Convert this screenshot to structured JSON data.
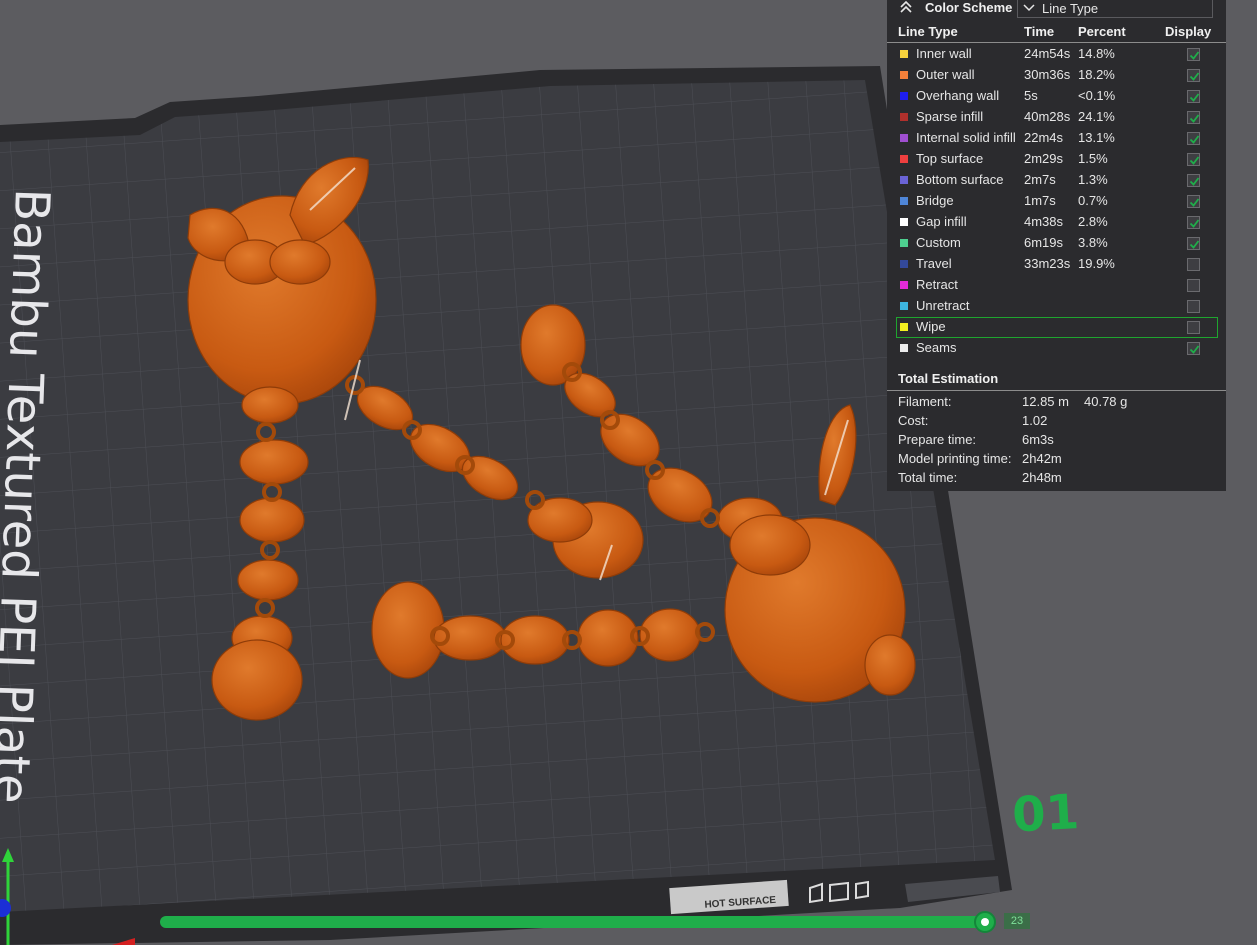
{
  "legend": {
    "scheme_title": "Color Scheme",
    "scheme_value": "Line Type",
    "headers": {
      "line_type": "Line Type",
      "time": "Time",
      "percent": "Percent",
      "display": "Display"
    },
    "rows": [
      {
        "name": "Inner wall",
        "time": "24m54s",
        "percent": "14.8%",
        "color": "#f7d23d",
        "display": true
      },
      {
        "name": "Outer wall",
        "time": "30m36s",
        "percent": "18.2%",
        "color": "#f5803a",
        "display": true
      },
      {
        "name": "Overhang wall",
        "time": "5s",
        "percent": "<0.1%",
        "color": "#1e1ef0",
        "display": true
      },
      {
        "name": "Sparse infill",
        "time": "40m28s",
        "percent": "24.1%",
        "color": "#b0302c",
        "display": true
      },
      {
        "name": "Internal solid infill",
        "time": "22m4s",
        "percent": "13.1%",
        "color": "#a04fd1",
        "display": true
      },
      {
        "name": "Top surface",
        "time": "2m29s",
        "percent": "1.5%",
        "color": "#ee3f3f",
        "display": true
      },
      {
        "name": "Bottom surface",
        "time": "2m7s",
        "percent": "1.3%",
        "color": "#6a63d6",
        "display": true
      },
      {
        "name": "Bridge",
        "time": "1m7s",
        "percent": "0.7%",
        "color": "#4f86d8",
        "display": true
      },
      {
        "name": "Gap infill",
        "time": "4m38s",
        "percent": "2.8%",
        "color": "#ffffff",
        "display": true
      },
      {
        "name": "Custom",
        "time": "6m19s",
        "percent": "3.8%",
        "color": "#4ecf8f",
        "display": true
      },
      {
        "name": "Travel",
        "time": "33m23s",
        "percent": "19.9%",
        "color": "#33499a",
        "display": false
      },
      {
        "name": "Retract",
        "time": "",
        "percent": "",
        "color": "#e22bd8",
        "display": false
      },
      {
        "name": "Unretract",
        "time": "",
        "percent": "",
        "color": "#3db5e0",
        "display": false
      },
      {
        "name": "Wipe",
        "time": "",
        "percent": "",
        "color": "#f2ef20",
        "display": false,
        "highlighted": true
      },
      {
        "name": "Seams",
        "time": "",
        "percent": "",
        "color": "#ececec",
        "display": true
      }
    ],
    "total_title": "Total Estimation",
    "estimation": [
      {
        "label": "Filament:",
        "value": "12.85 m",
        "value2": "40.78 g"
      },
      {
        "label": "Cost:",
        "value": "1.02",
        "value2": ""
      },
      {
        "label": "Prepare time:",
        "value": "6m3s",
        "value2": ""
      },
      {
        "label": "Model printing time:",
        "value": "2h42m",
        "value2": ""
      },
      {
        "label": "Total time:",
        "value": "2h48m",
        "value2": ""
      }
    ]
  },
  "plate": {
    "label": "Bambu Textured PEI Plate",
    "number": "01",
    "warning_text": "HOT SURFACE"
  },
  "slider": {
    "value": "23"
  },
  "colors": {
    "background": "#5c5c60",
    "plate": "#3b3c41",
    "model": "#c85a12",
    "accent": "#1fae4a"
  }
}
